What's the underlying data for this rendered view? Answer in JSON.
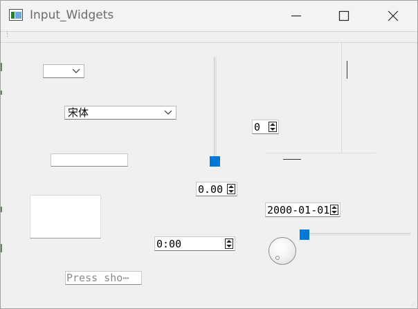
{
  "window": {
    "title": "Input_Widgets",
    "controls": [
      "minimize-icon",
      "maximize-icon",
      "close-icon"
    ]
  },
  "widgets": {
    "combo_small": {
      "value": ""
    },
    "font_combo": {
      "value": "宋体"
    },
    "line_edit": {
      "value": ""
    },
    "text_edit": {
      "value": ""
    },
    "time_edit": {
      "value": "0:00"
    },
    "key_sequence": {
      "placeholder": "Press sho⋯"
    },
    "double_spin": {
      "value": "0.00"
    },
    "int_spin": {
      "value": "0"
    },
    "date_edit": {
      "value": "2000-01-01"
    },
    "vertical_slider": {
      "value_fraction": 0.0
    },
    "horizontal_slider": {
      "value_fraction": 0.0
    },
    "dial": {
      "value_fraction": 0.0
    }
  },
  "colors": {
    "accent": "#0078d7",
    "window_bg": "#f0f0f0",
    "title_text": "#6b6b6b"
  }
}
